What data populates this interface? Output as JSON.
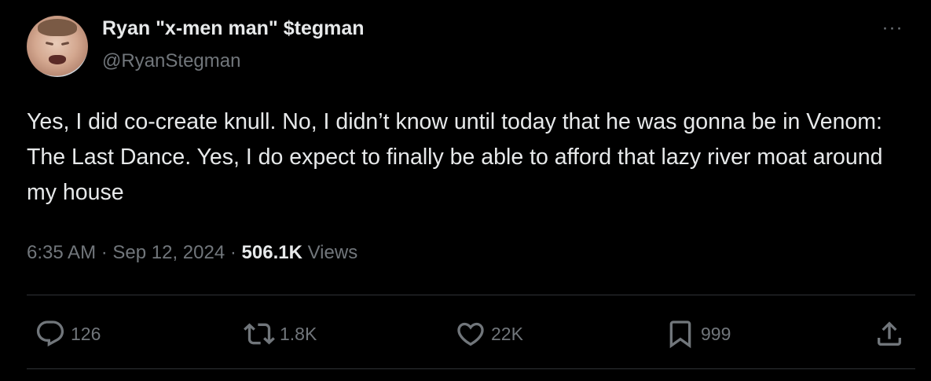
{
  "tweet": {
    "display_name": "Ryan \"x-men man\" $tegman",
    "handle": "@RyanStegman",
    "more_icon": "ellipsis-icon",
    "text": "Yes, I did co-create knull. No, I didn’t know until today that he was gonna be in Venom: The Last Dance. Yes, I do expect to finally be able to afford that lazy river moat around my house",
    "time": "6:35 AM",
    "separator": "·",
    "date": "Sep 12, 2024",
    "views_count": "506.1K",
    "views_label": "Views"
  },
  "actions": {
    "reply": {
      "icon": "reply-icon",
      "count": "126"
    },
    "retweet": {
      "icon": "retweet-icon",
      "count": "1.8K"
    },
    "like": {
      "icon": "heart-icon",
      "count": "22K"
    },
    "bookmark": {
      "icon": "bookmark-icon",
      "count": "999"
    },
    "share": {
      "icon": "share-icon"
    }
  },
  "colors": {
    "background": "#000000",
    "primary_text": "#e7e9ea",
    "secondary_text": "#71767b",
    "divider": "#2f3336"
  }
}
